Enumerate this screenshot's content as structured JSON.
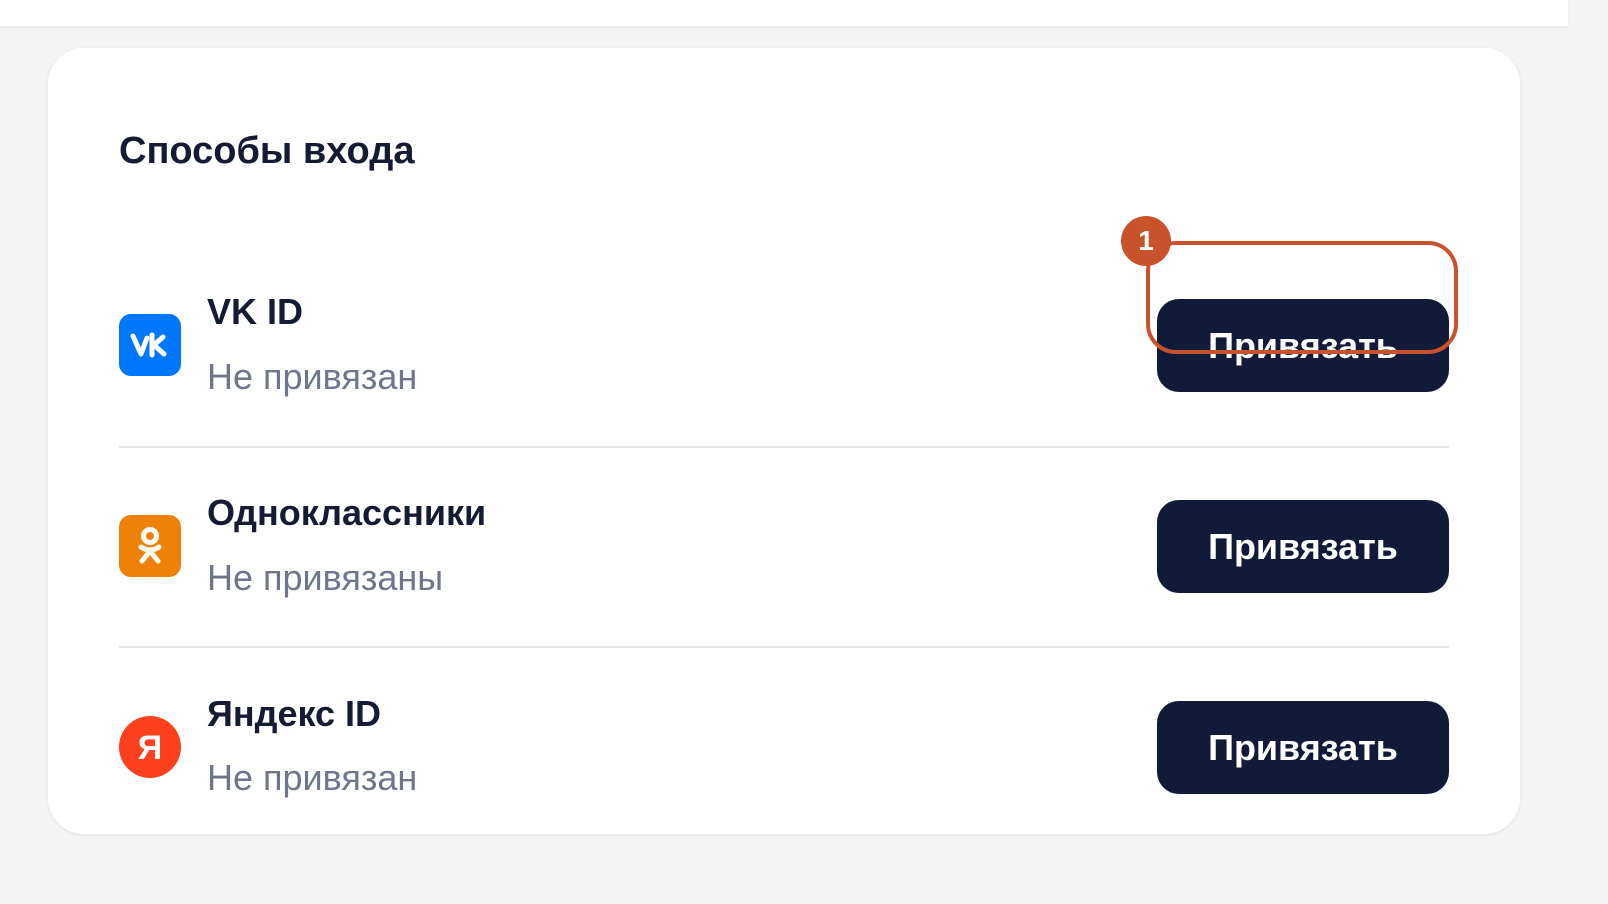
{
  "section": {
    "title": "Способы входа"
  },
  "providers": [
    {
      "name": "VK ID",
      "status": "Не привязан",
      "button_label": "Привязать",
      "icon": "vk-icon",
      "icon_color": "#0077ff"
    },
    {
      "name": "Одноклассники",
      "status": "Не привязаны",
      "button_label": "Привязать",
      "icon": "odnoklassniki-icon",
      "icon_color": "#ee8208"
    },
    {
      "name": "Яндекс ID",
      "status": "Не привязан",
      "button_label": "Привязать",
      "icon": "yandex-icon",
      "icon_color": "#fc3f1d",
      "icon_letter": "Я"
    }
  ],
  "annotation": {
    "step_number": "1",
    "color": "#c8532a"
  },
  "colors": {
    "button_bg": "#121a3a",
    "title_text": "#141b33",
    "status_text": "#6f7689",
    "page_bg": "#f4f4f4"
  }
}
